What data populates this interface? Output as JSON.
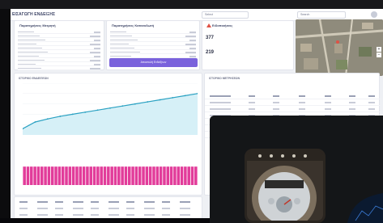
{
  "app": {
    "title": "ΕΙΣΑΓΩΓΗ ΕΝΔΕΙΞΗΣ"
  },
  "header": {
    "filter1": "Select",
    "filter2": "Search"
  },
  "card_left": {
    "title": "Παρατηρήσεις Μετρητή",
    "rows": [
      "",
      "",
      "",
      "",
      "",
      "",
      "",
      "",
      "",
      ""
    ]
  },
  "card_right": {
    "title": "Παρατηρήσεις Καταναλωτή",
    "rows": [
      "",
      "",
      "",
      "",
      "",
      "",
      ""
    ],
    "button_label": "Αποστολή Ενδείξεων"
  },
  "card_alerts": {
    "title": "Ειδοποιήσεις",
    "kpi1_value": "377",
    "kpi1_label": "",
    "kpi2_value": "219",
    "kpi2_label": ""
  },
  "chart_card": {
    "title": "ΙΣΤΟΡΙΚΟ ΕΝΔΕΙΞΕΩΝ"
  },
  "table_card": {
    "title": "ΙΣΤΟΡΙΚΟ ΜΕΤΡΗΣΕΩΝ"
  },
  "colors": {
    "accent": "#7a62dc",
    "line": "#2aa1c2",
    "bars": "#e23c9a",
    "alert": "#e05145"
  },
  "chart_data": [
    {
      "type": "line",
      "title": "",
      "x_range": [
        0,
        100
      ],
      "y_range": [
        0,
        100
      ],
      "series": [
        {
          "name": "",
          "values": [
            12,
            25,
            31,
            36,
            40,
            44,
            48,
            52,
            56,
            60,
            64,
            68,
            72,
            76,
            80
          ]
        }
      ]
    },
    {
      "type": "bar",
      "title": "",
      "series": [
        {
          "name": "",
          "values": [
            19,
            19,
            19,
            19,
            19,
            19,
            19,
            19,
            19,
            19,
            19,
            19,
            19,
            19,
            19,
            19,
            19,
            19,
            19,
            19,
            19,
            19,
            19,
            19,
            19,
            19,
            19,
            19,
            19,
            19,
            19,
            19,
            19,
            19,
            19,
            19,
            19,
            19,
            19,
            19,
            19,
            19,
            19,
            19,
            19,
            19,
            19,
            19,
            19,
            19
          ]
        }
      ]
    }
  ]
}
